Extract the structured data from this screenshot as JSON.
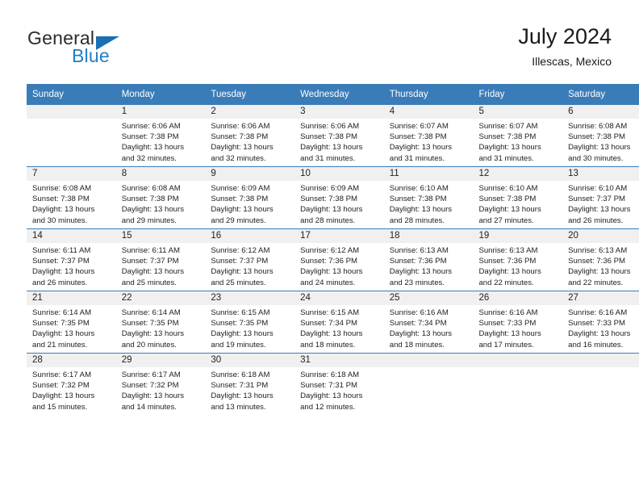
{
  "brand": {
    "name_part1": "General",
    "name_part2": "Blue"
  },
  "header": {
    "title": "July 2024",
    "subtitle": "Illescas, Mexico"
  },
  "colors": {
    "header_blue": "#3a7cb8",
    "logo_blue": "#1f7fc4",
    "daynum_bg": "#f0f0f0"
  },
  "weekdays": [
    "Sunday",
    "Monday",
    "Tuesday",
    "Wednesday",
    "Thursday",
    "Friday",
    "Saturday"
  ],
  "weeks": [
    [
      {
        "day": "",
        "sunrise": "",
        "sunset": "",
        "daylight1": "",
        "daylight2": ""
      },
      {
        "day": "1",
        "sunrise": "Sunrise: 6:06 AM",
        "sunset": "Sunset: 7:38 PM",
        "daylight1": "Daylight: 13 hours",
        "daylight2": "and 32 minutes."
      },
      {
        "day": "2",
        "sunrise": "Sunrise: 6:06 AM",
        "sunset": "Sunset: 7:38 PM",
        "daylight1": "Daylight: 13 hours",
        "daylight2": "and 32 minutes."
      },
      {
        "day": "3",
        "sunrise": "Sunrise: 6:06 AM",
        "sunset": "Sunset: 7:38 PM",
        "daylight1": "Daylight: 13 hours",
        "daylight2": "and 31 minutes."
      },
      {
        "day": "4",
        "sunrise": "Sunrise: 6:07 AM",
        "sunset": "Sunset: 7:38 PM",
        "daylight1": "Daylight: 13 hours",
        "daylight2": "and 31 minutes."
      },
      {
        "day": "5",
        "sunrise": "Sunrise: 6:07 AM",
        "sunset": "Sunset: 7:38 PM",
        "daylight1": "Daylight: 13 hours",
        "daylight2": "and 31 minutes."
      },
      {
        "day": "6",
        "sunrise": "Sunrise: 6:08 AM",
        "sunset": "Sunset: 7:38 PM",
        "daylight1": "Daylight: 13 hours",
        "daylight2": "and 30 minutes."
      }
    ],
    [
      {
        "day": "7",
        "sunrise": "Sunrise: 6:08 AM",
        "sunset": "Sunset: 7:38 PM",
        "daylight1": "Daylight: 13 hours",
        "daylight2": "and 30 minutes."
      },
      {
        "day": "8",
        "sunrise": "Sunrise: 6:08 AM",
        "sunset": "Sunset: 7:38 PM",
        "daylight1": "Daylight: 13 hours",
        "daylight2": "and 29 minutes."
      },
      {
        "day": "9",
        "sunrise": "Sunrise: 6:09 AM",
        "sunset": "Sunset: 7:38 PM",
        "daylight1": "Daylight: 13 hours",
        "daylight2": "and 29 minutes."
      },
      {
        "day": "10",
        "sunrise": "Sunrise: 6:09 AM",
        "sunset": "Sunset: 7:38 PM",
        "daylight1": "Daylight: 13 hours",
        "daylight2": "and 28 minutes."
      },
      {
        "day": "11",
        "sunrise": "Sunrise: 6:10 AM",
        "sunset": "Sunset: 7:38 PM",
        "daylight1": "Daylight: 13 hours",
        "daylight2": "and 28 minutes."
      },
      {
        "day": "12",
        "sunrise": "Sunrise: 6:10 AM",
        "sunset": "Sunset: 7:38 PM",
        "daylight1": "Daylight: 13 hours",
        "daylight2": "and 27 minutes."
      },
      {
        "day": "13",
        "sunrise": "Sunrise: 6:10 AM",
        "sunset": "Sunset: 7:37 PM",
        "daylight1": "Daylight: 13 hours",
        "daylight2": "and 26 minutes."
      }
    ],
    [
      {
        "day": "14",
        "sunrise": "Sunrise: 6:11 AM",
        "sunset": "Sunset: 7:37 PM",
        "daylight1": "Daylight: 13 hours",
        "daylight2": "and 26 minutes."
      },
      {
        "day": "15",
        "sunrise": "Sunrise: 6:11 AM",
        "sunset": "Sunset: 7:37 PM",
        "daylight1": "Daylight: 13 hours",
        "daylight2": "and 25 minutes."
      },
      {
        "day": "16",
        "sunrise": "Sunrise: 6:12 AM",
        "sunset": "Sunset: 7:37 PM",
        "daylight1": "Daylight: 13 hours",
        "daylight2": "and 25 minutes."
      },
      {
        "day": "17",
        "sunrise": "Sunrise: 6:12 AM",
        "sunset": "Sunset: 7:36 PM",
        "daylight1": "Daylight: 13 hours",
        "daylight2": "and 24 minutes."
      },
      {
        "day": "18",
        "sunrise": "Sunrise: 6:13 AM",
        "sunset": "Sunset: 7:36 PM",
        "daylight1": "Daylight: 13 hours",
        "daylight2": "and 23 minutes."
      },
      {
        "day": "19",
        "sunrise": "Sunrise: 6:13 AM",
        "sunset": "Sunset: 7:36 PM",
        "daylight1": "Daylight: 13 hours",
        "daylight2": "and 22 minutes."
      },
      {
        "day": "20",
        "sunrise": "Sunrise: 6:13 AM",
        "sunset": "Sunset: 7:36 PM",
        "daylight1": "Daylight: 13 hours",
        "daylight2": "and 22 minutes."
      }
    ],
    [
      {
        "day": "21",
        "sunrise": "Sunrise: 6:14 AM",
        "sunset": "Sunset: 7:35 PM",
        "daylight1": "Daylight: 13 hours",
        "daylight2": "and 21 minutes."
      },
      {
        "day": "22",
        "sunrise": "Sunrise: 6:14 AM",
        "sunset": "Sunset: 7:35 PM",
        "daylight1": "Daylight: 13 hours",
        "daylight2": "and 20 minutes."
      },
      {
        "day": "23",
        "sunrise": "Sunrise: 6:15 AM",
        "sunset": "Sunset: 7:35 PM",
        "daylight1": "Daylight: 13 hours",
        "daylight2": "and 19 minutes."
      },
      {
        "day": "24",
        "sunrise": "Sunrise: 6:15 AM",
        "sunset": "Sunset: 7:34 PM",
        "daylight1": "Daylight: 13 hours",
        "daylight2": "and 18 minutes."
      },
      {
        "day": "25",
        "sunrise": "Sunrise: 6:16 AM",
        "sunset": "Sunset: 7:34 PM",
        "daylight1": "Daylight: 13 hours",
        "daylight2": "and 18 minutes."
      },
      {
        "day": "26",
        "sunrise": "Sunrise: 6:16 AM",
        "sunset": "Sunset: 7:33 PM",
        "daylight1": "Daylight: 13 hours",
        "daylight2": "and 17 minutes."
      },
      {
        "day": "27",
        "sunrise": "Sunrise: 6:16 AM",
        "sunset": "Sunset: 7:33 PM",
        "daylight1": "Daylight: 13 hours",
        "daylight2": "and 16 minutes."
      }
    ],
    [
      {
        "day": "28",
        "sunrise": "Sunrise: 6:17 AM",
        "sunset": "Sunset: 7:32 PM",
        "daylight1": "Daylight: 13 hours",
        "daylight2": "and 15 minutes."
      },
      {
        "day": "29",
        "sunrise": "Sunrise: 6:17 AM",
        "sunset": "Sunset: 7:32 PM",
        "daylight1": "Daylight: 13 hours",
        "daylight2": "and 14 minutes."
      },
      {
        "day": "30",
        "sunrise": "Sunrise: 6:18 AM",
        "sunset": "Sunset: 7:31 PM",
        "daylight1": "Daylight: 13 hours",
        "daylight2": "and 13 minutes."
      },
      {
        "day": "31",
        "sunrise": "Sunrise: 6:18 AM",
        "sunset": "Sunset: 7:31 PM",
        "daylight1": "Daylight: 13 hours",
        "daylight2": "and 12 minutes."
      },
      {
        "day": "",
        "sunrise": "",
        "sunset": "",
        "daylight1": "",
        "daylight2": ""
      },
      {
        "day": "",
        "sunrise": "",
        "sunset": "",
        "daylight1": "",
        "daylight2": ""
      },
      {
        "day": "",
        "sunrise": "",
        "sunset": "",
        "daylight1": "",
        "daylight2": ""
      }
    ]
  ]
}
